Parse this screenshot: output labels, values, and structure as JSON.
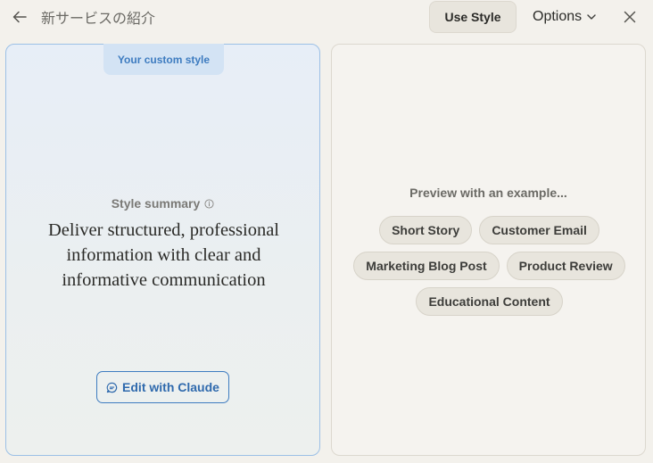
{
  "header": {
    "title": "新サービスの紹介",
    "use_style_label": "Use Style",
    "options_label": "Options"
  },
  "left_panel": {
    "tag": "Your custom style",
    "summary_label": "Style summary",
    "summary_text": "Deliver structured, professional information with clear and informative communication",
    "edit_button_label": "Edit with Claude"
  },
  "right_panel": {
    "preview_label": "Preview with an example...",
    "examples": [
      "Short Story",
      "Customer Email",
      "Marketing Blog Post",
      "Product Review",
      "Educational Content"
    ]
  },
  "icons": {
    "back": "arrow-left-icon",
    "options": "chevron-down-icon",
    "close": "close-icon",
    "info": "info-icon",
    "chat": "chat-bubble-icon"
  },
  "colors": {
    "accent": "#3e7cc0",
    "background": "#f3f1ec",
    "chip": "#e8e5dd"
  }
}
